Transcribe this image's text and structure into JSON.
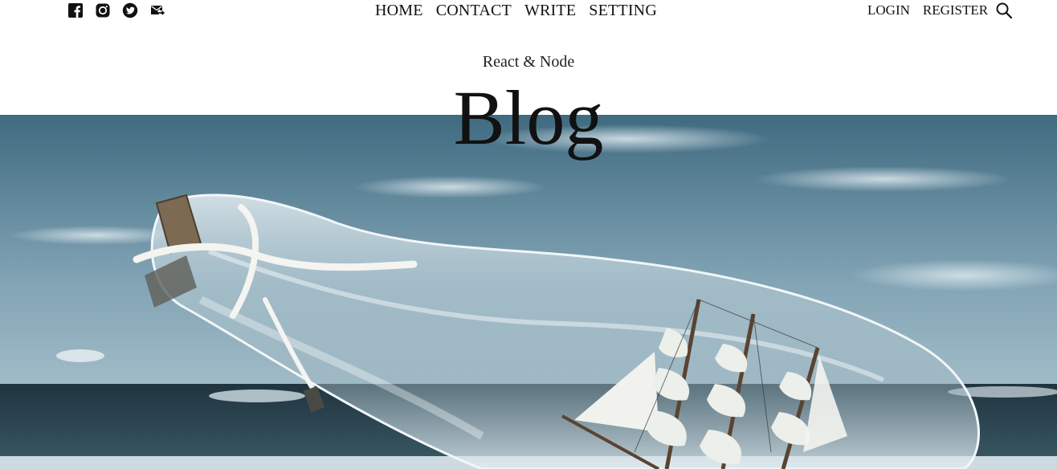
{
  "social": {
    "icons": [
      "facebook-icon",
      "instagram-icon",
      "twitter-icon",
      "mail-icon"
    ]
  },
  "menu": {
    "items": [
      "HOME",
      "CONTACT",
      "WRITE",
      "SETTING"
    ]
  },
  "auth": {
    "login": "LOGIN",
    "register": "REGISTER"
  },
  "header": {
    "subtitle": "React & Node",
    "title": "Blog"
  },
  "hero": {
    "description_icon": "bottle-ship-image"
  }
}
